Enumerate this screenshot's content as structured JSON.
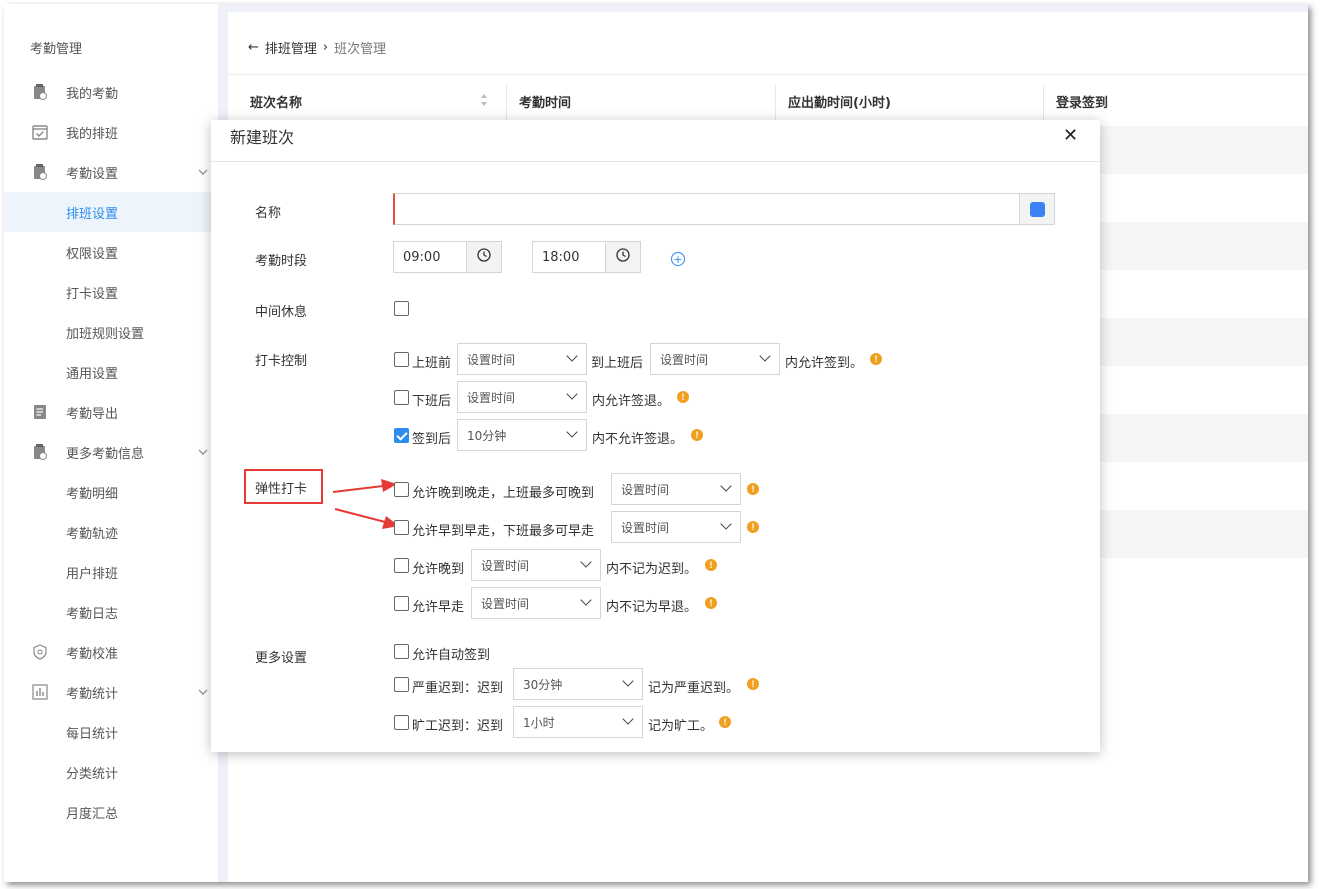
{
  "sidebar": {
    "title": "考勤管理",
    "items": [
      {
        "label": "我的考勤",
        "icon": "attendance-doc-icon"
      },
      {
        "label": "我的排班",
        "icon": "calendar-check-icon"
      },
      {
        "label": "考勤设置",
        "icon": "attendance-settings-icon",
        "chevron": "chevron-down-icon"
      },
      {
        "label": "排班设置",
        "active": true
      },
      {
        "label": "权限设置"
      },
      {
        "label": "打卡设置"
      },
      {
        "label": "加班规则设置"
      },
      {
        "label": "通用设置"
      },
      {
        "label": "考勤导出",
        "icon": "export-doc-icon"
      },
      {
        "label": "更多考勤信息",
        "icon": "more-info-icon",
        "chevron": "chevron-down-icon"
      },
      {
        "label": "考勤明细"
      },
      {
        "label": "考勤轨迹"
      },
      {
        "label": "用户排班"
      },
      {
        "label": "考勤日志"
      },
      {
        "label": "考勤校准",
        "icon": "shield-icon"
      },
      {
        "label": "考勤统计",
        "icon": "bar-chart-icon",
        "chevron": "chevron-down-icon"
      },
      {
        "label": "每日统计"
      },
      {
        "label": "分类统计"
      },
      {
        "label": "月度汇总"
      }
    ]
  },
  "breadcrumb": {
    "back_arrow": "←",
    "parent": "排班管理",
    "separator": "›",
    "current": "班次管理"
  },
  "table": {
    "headers": [
      "班次名称",
      "考勤时间",
      "应出勤时间(小时)",
      "登录签到"
    ]
  },
  "modal": {
    "title": "新建班次",
    "close": "✕",
    "name_label": "名称",
    "name_value": "",
    "period_label": "考勤时段",
    "start_time": "09:00",
    "end_time": "18:00",
    "break_label": "中间休息",
    "punch_label": "打卡控制",
    "punch": {
      "r1": {
        "a": "上班前",
        "sel1": "设置时间",
        "b": "到上班后",
        "sel2": "设置时间",
        "c": "内允许签到。"
      },
      "r2": {
        "a": "下班后",
        "sel1": "设置时间",
        "c": "内允许签退。"
      },
      "r3": {
        "a": "签到后",
        "sel1": "10分钟",
        "c": "内不允许签退。",
        "checked": true
      }
    },
    "flex_label": "弹性打卡",
    "flex": {
      "r1": {
        "a": "允许晚到晚走，上班最多可晚到",
        "sel1": "设置时间"
      },
      "r2": {
        "a": "允许早到早走，下班最多可早走",
        "sel1": "设置时间"
      },
      "r3": {
        "a": "允许晚到",
        "sel1": "设置时间",
        "c": "内不记为迟到。"
      },
      "r4": {
        "a": "允许早走",
        "sel1": "设置时间",
        "c": "内不记为早退。"
      }
    },
    "more_label": "更多设置",
    "more": {
      "r1": {
        "a": "允许自动签到"
      },
      "r2": {
        "a": "严重迟到：迟到",
        "sel1": "30分钟",
        "c": "记为严重迟到。"
      },
      "r3": {
        "a": "旷工迟到：迟到",
        "sel1": "1小时",
        "c": "记为旷工。"
      }
    },
    "info_glyph": "!",
    "plus_glyph": "+"
  },
  "colors": {
    "accent": "#2d8cf0",
    "warn": "#f0a020",
    "annotation": "#e53935"
  }
}
